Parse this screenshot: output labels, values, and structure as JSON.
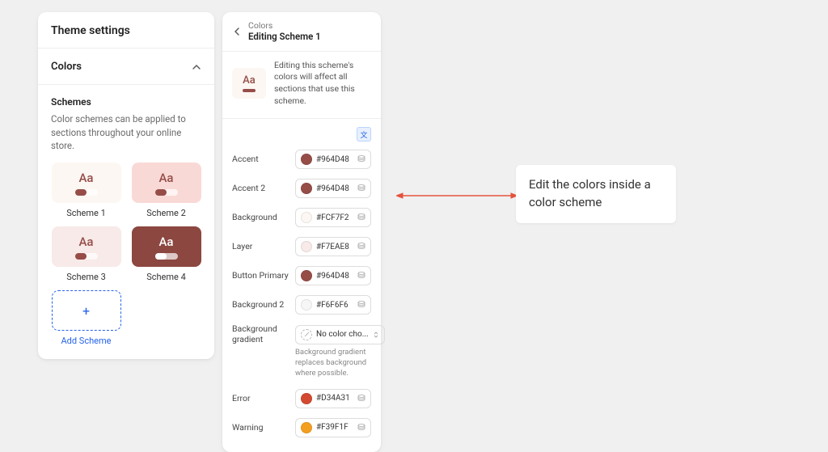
{
  "left": {
    "title": "Theme settings",
    "section": "Colors",
    "sub_heading": "Schemes",
    "sub_desc": "Color schemes can be applied to sections throughout your online store.",
    "schemes": [
      {
        "label": "Scheme 1",
        "bg": "#FCF7F2",
        "fg": "#964D48",
        "knob": "#964D48"
      },
      {
        "label": "Scheme 2",
        "bg": "#F9D9D6",
        "fg": "#964D48",
        "knob": "#964D48"
      },
      {
        "label": "Scheme 3",
        "bg": "#F7EAE8",
        "fg": "#964D48",
        "knob": "#964D48"
      },
      {
        "label": "Scheme 4",
        "bg": "#8B4740",
        "fg": "#FFFFFF",
        "knob": "#FFFFFF"
      }
    ],
    "add_label": "Add Scheme",
    "add_plus": "+"
  },
  "right": {
    "crumb_parent": "Colors",
    "crumb_current": "Editing Scheme 1",
    "info_text": "Editing this scheme's colors will affect all sections that use this scheme.",
    "preview": {
      "bg": "#FCF7F2",
      "fg": "#964D48",
      "knob": "#964D48"
    },
    "translate_glyph": "文",
    "fields": [
      {
        "label": "Accent",
        "value": "#964D48",
        "swatch": "#964D48"
      },
      {
        "label": "Accent 2",
        "value": "#964D48",
        "swatch": "#964D48"
      },
      {
        "label": "Background",
        "value": "#FCF7F2",
        "swatch": "#FCF7F2"
      },
      {
        "label": "Layer",
        "value": "#F7EAE8",
        "swatch": "#F7EAE8"
      },
      {
        "label": "Button Primary",
        "value": "#964D48",
        "swatch": "#964D48"
      },
      {
        "label": "Background 2",
        "value": "#F6F6F6",
        "swatch": "#F6F6F6"
      }
    ],
    "gradient": {
      "label": "Background gradient",
      "value": "No color cho...",
      "help": "Background gradient replaces background where possible."
    },
    "extra": [
      {
        "label": "Error",
        "value": "#D34A31",
        "swatch": "#D34A31"
      },
      {
        "label": "Warning",
        "value": "#F39F1F",
        "swatch": "#F39F1F"
      }
    ]
  },
  "annotation": "Edit the colors inside a color scheme"
}
